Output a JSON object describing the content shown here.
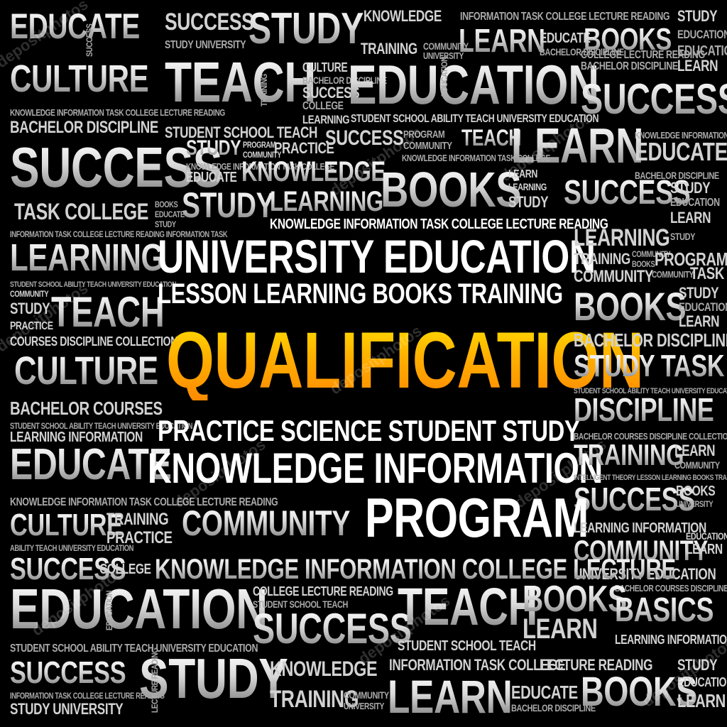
{
  "headline": "QUALIFICATION",
  "watermark": "depositphotos",
  "accent_color": "#ffa500",
  "words": {
    "w1": "EDUCATE",
    "w2": "SUCCESS",
    "w3": "STUDY",
    "w4": "KNOWLEDGE",
    "w5": "INFORMATION TASK COLLEGE LECTURE READING",
    "w6": "STUDY",
    "w7": "EDUCATION",
    "w8": "TRAINING",
    "w9": "COMMUNITY",
    "w10": "UNIVERSITY",
    "w11": "STUDY UNIVERSITY",
    "w12": "LEARN",
    "w13": "EDUCATE",
    "w14": "BOOKS",
    "w15": "EDUCATION",
    "w16": "CULTURE",
    "w17": "TEACH",
    "w18": "CULTURE",
    "w19": "BACHELOR DISCIPLINE",
    "w20": "SUCCESS",
    "w21": "COLLEGE",
    "w22": "EDUCATION",
    "w23": "SUCCESS",
    "w24": "BACHELOR DISCIPLINE",
    "w25": "COLLEGE LECTURE READING",
    "w26": "LEARN",
    "w27": "BACHELOR DISCIPLINE",
    "w28": "LEARNING",
    "w29": "STUDENT SCHOOL ABILITY TEACH UNIVERSITY EDUCATION",
    "w30": "KNOWLEDGE INFORMATION TASK COLLEGE LECTURE READING",
    "w31": "STUDENT SCHOOL TEACH",
    "w32": "SUCCESS",
    "w33": "PROGRAM",
    "w34": "COMMUNITY",
    "w35": "TEACH",
    "w36": "LEARN",
    "w37": "KNOWLEDGE INFORMATION TASK COLLEGE",
    "w38": "BACHELOR DISCIPLINE",
    "w39": "EDUCATE",
    "w40": "SUCCESS",
    "w41": "STUDY",
    "w42": "PRACTICE",
    "w43": "TASK",
    "w44": "KNOWLEDGE",
    "w45": "BOOKS",
    "w46": "EDUCATE",
    "w47": "LEARN",
    "w48": "SUCCESS",
    "w49": "STUDY",
    "w50": "EDUCATION",
    "w51": "TASK COLLEGE",
    "w52": "BOOKS",
    "w53": "EDUCATE",
    "w54": "STUDY",
    "w55": "STUDY",
    "w56": "LEARNING",
    "w57": "KNOWLEDGE INFORMATION TASK COLLEGE LECTURE READING",
    "w58": "LEARN",
    "w59": "INFORMATION TASK COLLEGE LECTURE READING INFORMATION TASK",
    "w60": "UNIVERSITY EDUCATION",
    "w61": "LEARNING",
    "w62": "LESSON LEARNING BOOKS TRAINING",
    "w63": "TRAINING",
    "w64": "PROGRAM",
    "w65": "BOOKS",
    "w66": "COMMUNITY",
    "w67": "COMMUNITY",
    "w68": "TASK",
    "w69": "LEARNING",
    "w70": "STUDENT SCHOOL ABILITY TEACH UNIVERSITY EDUCATION",
    "w71": "STUDY",
    "w72": "TEACH",
    "w73": "BOOKS",
    "w74": "STUDY",
    "w75": "PRACTICE",
    "w76": "BACHELOR DISCIPLINE",
    "w77": "COURSES DISCIPLINE COLLECTION",
    "w78": "STUDY TASK",
    "w79": "CULTURE",
    "w80": "BACHELOR COURSES",
    "w81": "DISCIPLINE",
    "w82": "PRACTICE SCIENCE STUDENT STUDY",
    "w83": "LEARNING INFORMATION",
    "w84": "BACHELOR COURSES DISCIPLINE COLLECTION",
    "w85": "EDUCATE",
    "w86": "KNOWLEDGE INFORMATION",
    "w87": "TRAINING",
    "w88": "LEARN",
    "w89": "INTELLIGENT THEORY LESSON LEARNING BOOKS TRAINING",
    "w90": "KNOWLEDGE INFORMATION TASK COLLEGE LECTURE READING",
    "w91": "SUCCESS",
    "w92": "BOOKS",
    "w93": "CULTURE",
    "w94": "TRAINING",
    "w95": "PRACTICE",
    "w96": "COMMUNITY",
    "w97": "PROGRAM",
    "w98": "LEARNING INFORMATION",
    "w99": "ABILITY TEACH UNIVERSITY EDUCATION",
    "w100": "COMMUNITY",
    "w101": "SUCCESS",
    "w102": "COLLEGE",
    "w103": "KNOWLEDGE INFORMATION COLLEGE LECTURE",
    "w104": "UNIVERSITY EDUCATION",
    "w105": "EDUCATION",
    "w106": "COLLEGE LECTURE READING",
    "w107": "TEACH",
    "w108": "BOOKS",
    "w109": "BASICS",
    "w110": "STUDENT SCHOOL ABILITY TEACH UNIVERSITY EDUCATION",
    "w111": "SUCCESS",
    "w112": "LEARN",
    "w113": "STUDENT SCHOOL TEACH",
    "w114": "LEARNING INFORMATION",
    "w115": "SUCCESS",
    "w116": "STUDY",
    "w117": "KNOWLEDGE",
    "w118": "INFORMATION TASK COLLEGE",
    "w119": "LECTURE READING",
    "w120": "STUDY",
    "w121": "STUDY UNIVERSITY",
    "w122": "TRAINING",
    "w123": "COMMUNITY",
    "w124": "LEARN",
    "w125": "EDUCATE",
    "w126": "BOOKS",
    "w127": "LEARN",
    "w128": "EDUCATION",
    "w129": "SUCCESS",
    "w130": "UNIVERSITY",
    "w131": "LEARN",
    "w132": "BACHELOR DISCIPLINE",
    "w133": "CULTURE",
    "w134": "STUDY",
    "w135": "LEARN",
    "w136": "LECTURE READING"
  }
}
